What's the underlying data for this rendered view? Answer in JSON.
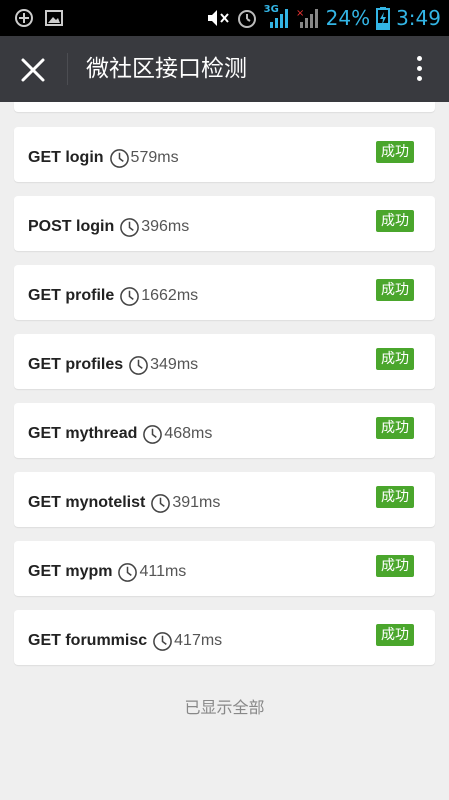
{
  "status_bar": {
    "battery_text": "24%",
    "clock": "3:49",
    "network_label": "3G",
    "accent_color": "#33b5e5"
  },
  "title_bar": {
    "title": "微社区接口检测"
  },
  "results": [
    {
      "endpoint": "GET login",
      "time": "579ms",
      "status": "成功"
    },
    {
      "endpoint": "POST login",
      "time": "396ms",
      "status": "成功"
    },
    {
      "endpoint": "GET profile",
      "time": "1662ms",
      "status": "成功"
    },
    {
      "endpoint": "GET profiles",
      "time": "349ms",
      "status": "成功"
    },
    {
      "endpoint": "GET mythread",
      "time": "468ms",
      "status": "成功"
    },
    {
      "endpoint": "GET mynotelist",
      "time": "391ms",
      "status": "成功"
    },
    {
      "endpoint": "GET mypm",
      "time": "411ms",
      "status": "成功"
    },
    {
      "endpoint": "GET forummisc",
      "time": "417ms",
      "status": "成功"
    }
  ],
  "footer": {
    "text": "已显示全部"
  },
  "colors": {
    "success_badge": "#4aa62c",
    "title_bar_bg": "#393a3f"
  }
}
